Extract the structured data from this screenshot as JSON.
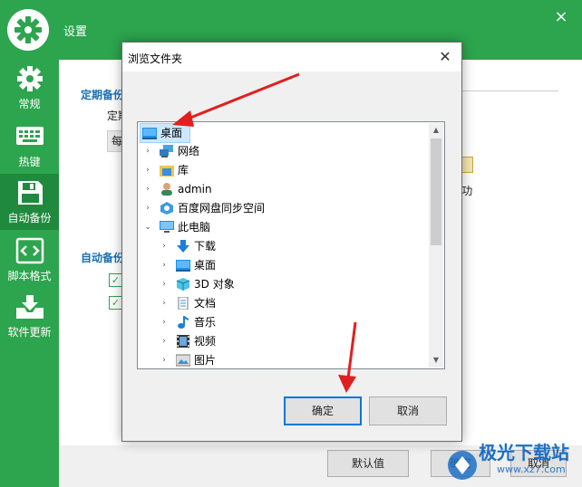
{
  "app": {
    "title": "设置",
    "close_glyph": "×"
  },
  "sidebar": {
    "items": [
      {
        "label": "常规",
        "icon": "gear-icon"
      },
      {
        "label": "热键",
        "icon": "keyboard-icon"
      },
      {
        "label": "自动备份",
        "icon": "floppy-disk-icon",
        "active": true
      },
      {
        "label": "脚本格式",
        "icon": "code-icon"
      },
      {
        "label": "软件更新",
        "icon": "download-tray-icon"
      }
    ]
  },
  "content": {
    "scheduled_backup_title": "定期备份",
    "scheduled_row_prefix": "定期",
    "select_value_prefix": "每",
    "partial_text": "”功",
    "auto_backup_title": "自动备份",
    "checkbox_mark": "✓"
  },
  "bottom_bar": {
    "default_button": "默认值",
    "ok_button": "确定",
    "cancel_button": "取消"
  },
  "dialog": {
    "title": "浏览文件夹",
    "close_glyph": "✕",
    "tree": [
      {
        "label": "桌面",
        "icon": "desktop-icon",
        "level": 0,
        "expander": "",
        "selected": true
      },
      {
        "label": "网络",
        "icon": "network-icon",
        "level": 1,
        "expander": "›"
      },
      {
        "label": "库",
        "icon": "library-icon",
        "level": 1,
        "expander": "›"
      },
      {
        "label": "admin",
        "icon": "user-icon",
        "level": 1,
        "expander": "›"
      },
      {
        "label": "百度网盘同步空间",
        "icon": "baidu-sync-icon",
        "level": 1,
        "expander": "›"
      },
      {
        "label": "此电脑",
        "icon": "computer-icon",
        "level": 1,
        "expander": "⌄"
      },
      {
        "label": "下载",
        "icon": "download-arrow-icon",
        "level": 2,
        "expander": "›"
      },
      {
        "label": "桌面",
        "icon": "desktop-icon",
        "level": 2,
        "expander": "›"
      },
      {
        "label": "3D 对象",
        "icon": "3d-objects-icon",
        "level": 2,
        "expander": "›"
      },
      {
        "label": "文档",
        "icon": "document-icon",
        "level": 2,
        "expander": "›"
      },
      {
        "label": "音乐",
        "icon": "music-note-icon",
        "level": 2,
        "expander": "›"
      },
      {
        "label": "视频",
        "icon": "film-icon",
        "level": 2,
        "expander": "›"
      },
      {
        "label": "图片",
        "icon": "picture-icon",
        "level": 2,
        "expander": "›"
      }
    ],
    "ok_button": "确定",
    "cancel_button": "取消"
  },
  "watermark": {
    "brand": "极光下载站",
    "url": "www.xz7.com"
  },
  "colors": {
    "brand_green": "#2da44e",
    "accent_blue": "#1b6fb0",
    "annotation_red": "#e02020"
  }
}
